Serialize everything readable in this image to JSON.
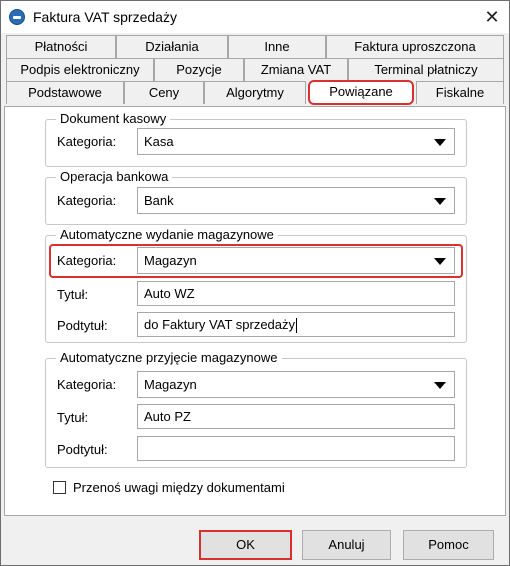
{
  "window": {
    "title": "Faktura VAT sprzedaży",
    "close_glyph": "✕"
  },
  "tabs": {
    "row1": [
      "Płatności",
      "Działania",
      "Inne",
      "Faktura uproszczona"
    ],
    "row2": [
      "Podpis elektroniczny",
      "Pozycje",
      "Zmiana VAT",
      "Terminal płatniczy"
    ],
    "row3": [
      "Podstawowe",
      "Ceny",
      "Algorytmy",
      "Powiązane",
      "Fiskalne"
    ],
    "active": "Powiązane"
  },
  "groups": {
    "kasowy": {
      "title": "Dokument kasowy",
      "kategoria_label": "Kategoria:",
      "kategoria_value": "Kasa"
    },
    "bankowa": {
      "title": "Operacja bankowa",
      "kategoria_label": "Kategoria:",
      "kategoria_value": "Bank"
    },
    "wydanie": {
      "title": "Automatyczne wydanie magazynowe",
      "kategoria_label": "Kategoria:",
      "kategoria_value": "Magazyn",
      "tytul_label": "Tytuł:",
      "tytul_value": "Auto WZ",
      "podtytul_label": "Podtytuł:",
      "podtytul_value": "do Faktury VAT sprzedaży"
    },
    "przyjecie": {
      "title": "Automatyczne przyjęcie magazynowe",
      "kategoria_label": "Kategoria:",
      "kategoria_value": "Magazyn",
      "tytul_label": "Tytuł:",
      "tytul_value": "Auto PZ",
      "podtytul_label": "Podtytuł:",
      "podtytul_value": ""
    }
  },
  "checkbox": {
    "label": "Przenoś uwagi między dokumentami",
    "checked": false
  },
  "buttons": {
    "ok": "OK",
    "cancel": "Anuluj",
    "help": "Pomoc"
  },
  "colors": {
    "highlight": "#d9312f",
    "window_bg": "#f0f0f0",
    "panel_bg": "#ffffff",
    "border": "#a7a7a7"
  }
}
